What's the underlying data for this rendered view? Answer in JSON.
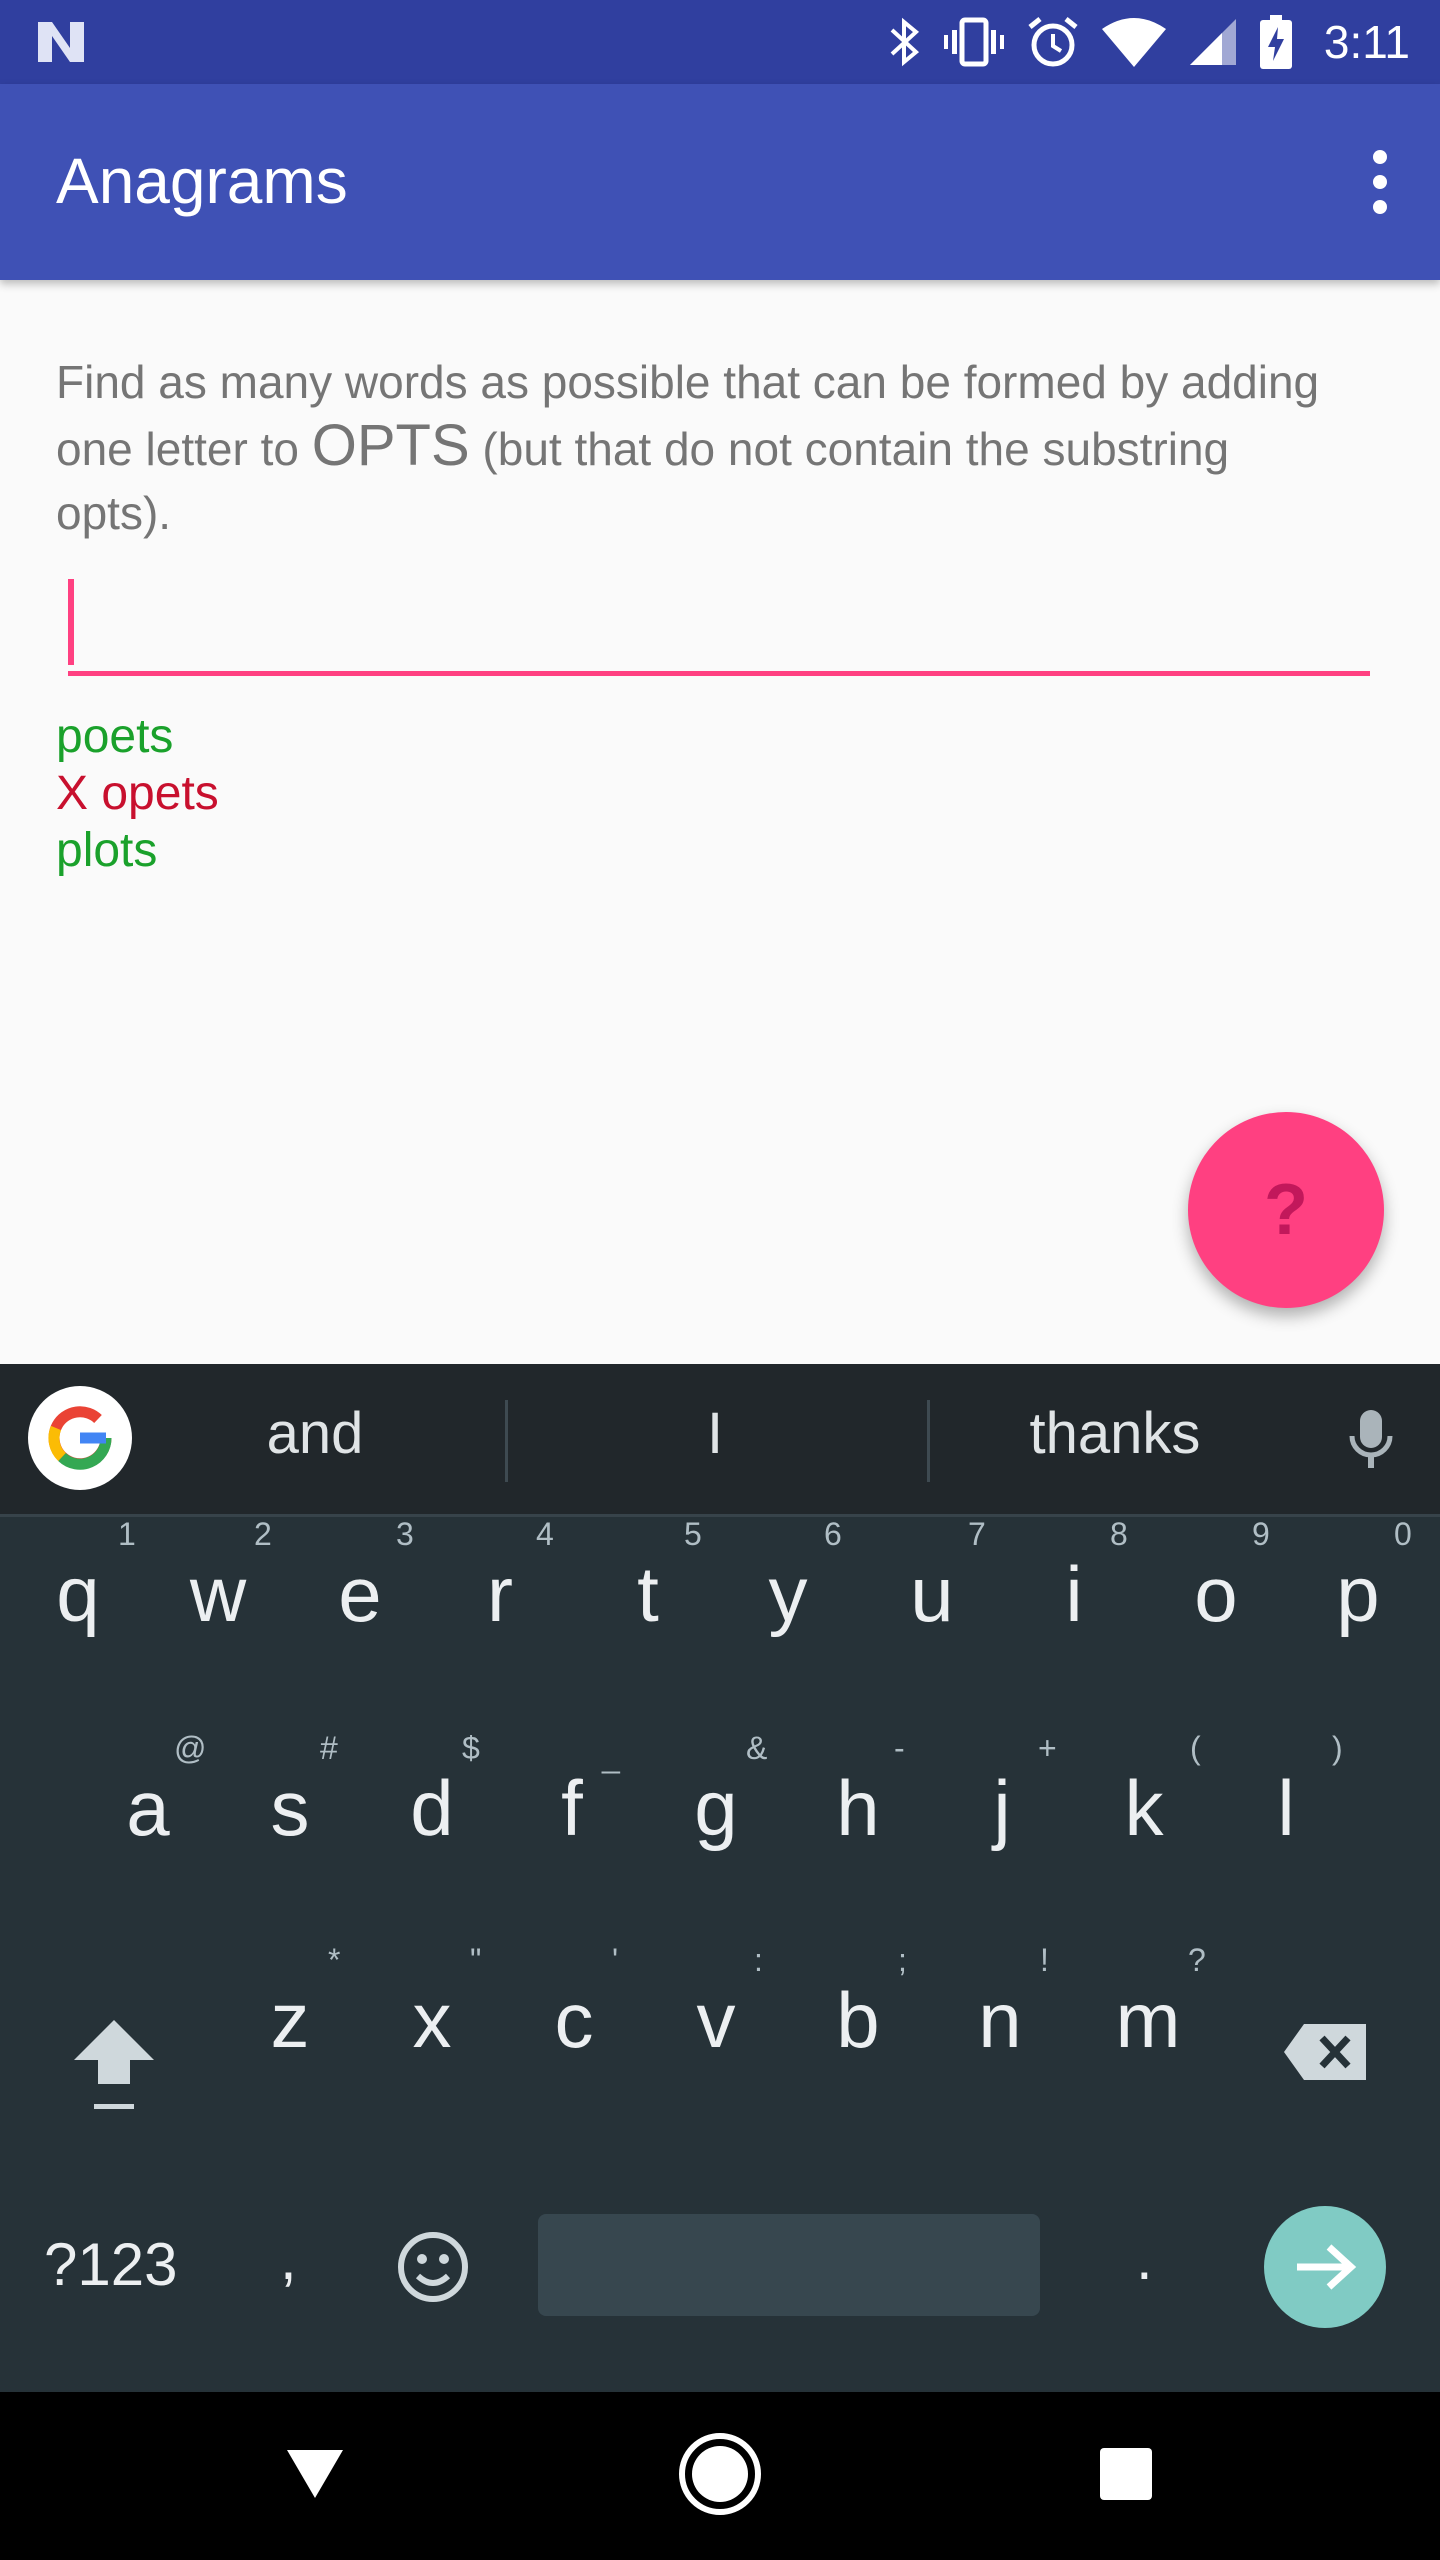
{
  "status_bar": {
    "time": "3:11"
  },
  "app_bar": {
    "title": "Anagrams"
  },
  "instructions": {
    "part1": "Find as many words as possible that can be formed by adding one letter to ",
    "word": "OPTS",
    "part2": " (but that do not contain the substring opts)."
  },
  "input": {
    "value": ""
  },
  "results": [
    {
      "text": "poets",
      "status": "ok"
    },
    {
      "text": "X opets",
      "status": "bad"
    },
    {
      "text": "plots",
      "status": "ok"
    }
  ],
  "fab": {
    "label": "?"
  },
  "keyboard": {
    "suggestions": [
      "and",
      "I",
      "thanks"
    ],
    "row1": [
      {
        "k": "q",
        "h": "1"
      },
      {
        "k": "w",
        "h": "2"
      },
      {
        "k": "e",
        "h": "3"
      },
      {
        "k": "r",
        "h": "4"
      },
      {
        "k": "t",
        "h": "5"
      },
      {
        "k": "y",
        "h": "6"
      },
      {
        "k": "u",
        "h": "7"
      },
      {
        "k": "i",
        "h": "8"
      },
      {
        "k": "o",
        "h": "9"
      },
      {
        "k": "p",
        "h": "0"
      }
    ],
    "row2": [
      {
        "k": "a",
        "h": "@"
      },
      {
        "k": "s",
        "h": "#"
      },
      {
        "k": "d",
        "h": "$"
      },
      {
        "k": "f",
        "h": "_"
      },
      {
        "k": "g",
        "h": "&"
      },
      {
        "k": "h",
        "h": "-"
      },
      {
        "k": "j",
        "h": "+"
      },
      {
        "k": "k",
        "h": "("
      },
      {
        "k": "l",
        "h": ")"
      }
    ],
    "row3": [
      {
        "k": "z",
        "h": "*"
      },
      {
        "k": "x",
        "h": "\""
      },
      {
        "k": "c",
        "h": "'"
      },
      {
        "k": "v",
        "h": ":"
      },
      {
        "k": "b",
        "h": ";"
      },
      {
        "k": "n",
        "h": "!"
      },
      {
        "k": "m",
        "h": "?"
      }
    ],
    "symbols_label": "?123",
    "comma": ",",
    "period": "."
  },
  "colors": {
    "primary": "#3f51b5",
    "primary_dark": "#303f9f",
    "accent": "#ff4081",
    "correct": "#1aa12b",
    "wrong": "#c8102e"
  }
}
